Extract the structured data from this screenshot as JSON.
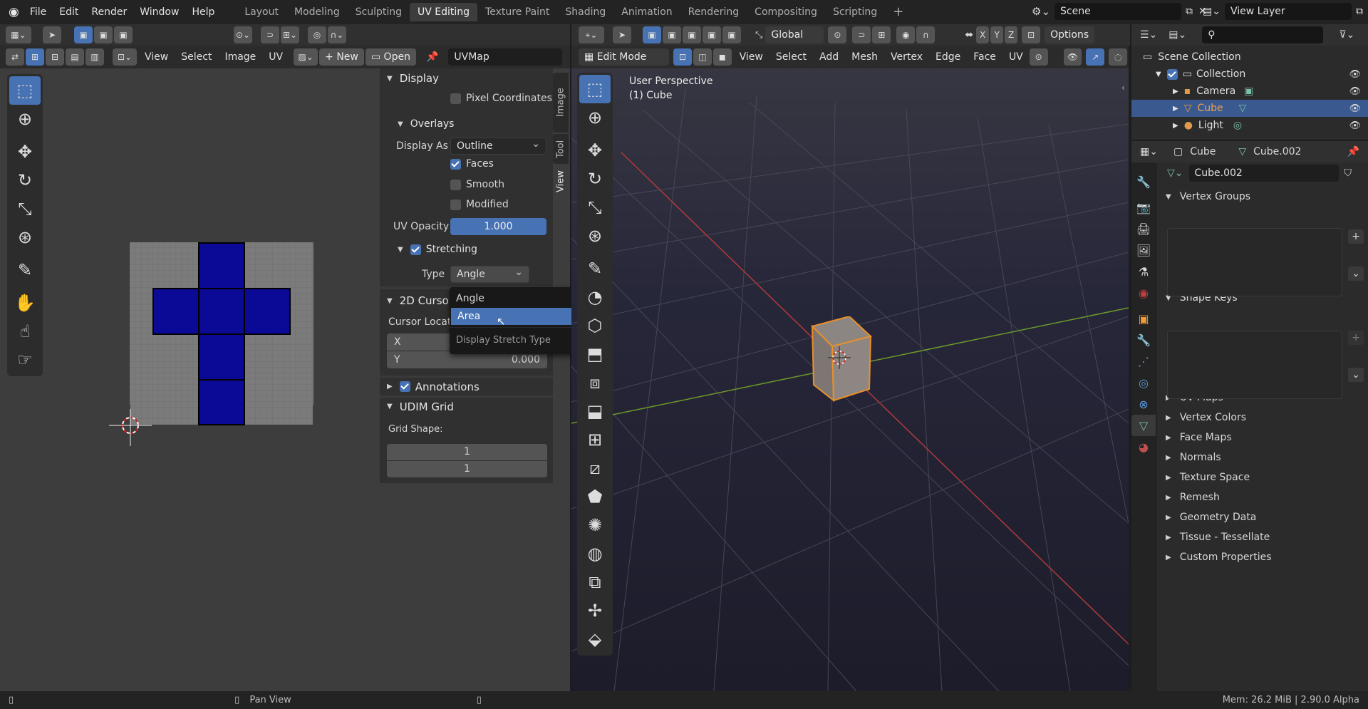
{
  "topbar": {
    "menus": [
      "File",
      "Edit",
      "Render",
      "Window",
      "Help"
    ],
    "workspaces": [
      "Layout",
      "Modeling",
      "Sculpting",
      "UV Editing",
      "Texture Paint",
      "Shading",
      "Animation",
      "Rendering",
      "Compositing",
      "Scripting"
    ],
    "active_workspace": "UV Editing",
    "scene": "Scene",
    "view_layer": "View Layer",
    "add_tab": "+"
  },
  "uv_editor": {
    "menus": [
      "View",
      "Select",
      "Image",
      "UV"
    ],
    "new_label": "New",
    "open_label": "Open",
    "uvmap": "UVMap",
    "accent": "#4772b3",
    "face_color": "#0a0a96"
  },
  "sidebar": {
    "tabs": [
      "Image",
      "Tool",
      "View"
    ],
    "display": {
      "title": "Display",
      "pixel_coordinates": "Pixel Coordinates",
      "overlays": {
        "title": "Overlays",
        "display_as_label": "Display As",
        "display_as_value": "Outline",
        "faces": "Faces",
        "smooth": "Smooth",
        "modified": "Modified",
        "uv_opacity_label": "UV Opacity",
        "uv_opacity_value": "1.000"
      },
      "stretching": {
        "title": "Stretching",
        "type_label": "Type",
        "type_value": "Angle"
      }
    },
    "cursor": {
      "title": "2D Cursor",
      "location_label": "Cursor Locati",
      "x_label": "X",
      "y_label": "Y",
      "y_value": "0.000"
    },
    "annotations": "Annotations",
    "udim": {
      "title": "UDIM Grid",
      "grid_shape_label": "Grid Shape:",
      "values": [
        "1",
        "1"
      ]
    }
  },
  "dropdown": {
    "options": [
      "Angle",
      "Area"
    ],
    "highlighted": "Area",
    "tooltip": "Display Stretch Type"
  },
  "viewport": {
    "mode": "Edit Mode",
    "orientation": "Global",
    "options": "Options",
    "menus": [
      "View",
      "Select",
      "Add",
      "Mesh",
      "Vertex",
      "Edge",
      "Face",
      "UV"
    ],
    "axes": [
      "X",
      "Y",
      "Z"
    ],
    "perspective": "User Perspective",
    "object": "(1) Cube"
  },
  "outliner": {
    "root": "Scene Collection",
    "collection": "Collection",
    "items": [
      "Camera",
      "Cube",
      "Light"
    ],
    "selected": "Cube"
  },
  "properties": {
    "object": "Cube",
    "mesh": "Cube.002",
    "mesh_field": "Cube.002",
    "open_sections": [
      "Vertex Groups",
      "Shape Keys"
    ],
    "closed_sections": [
      "UV Maps",
      "Vertex Colors",
      "Face Maps",
      "Normals",
      "Texture Space",
      "Remesh",
      "Geometry Data",
      "Tissue - Tessellate",
      "Custom Properties"
    ]
  },
  "status": {
    "pan": "Pan View",
    "mem": "Mem: 26.2 MiB | 2.90.0 Alpha"
  }
}
